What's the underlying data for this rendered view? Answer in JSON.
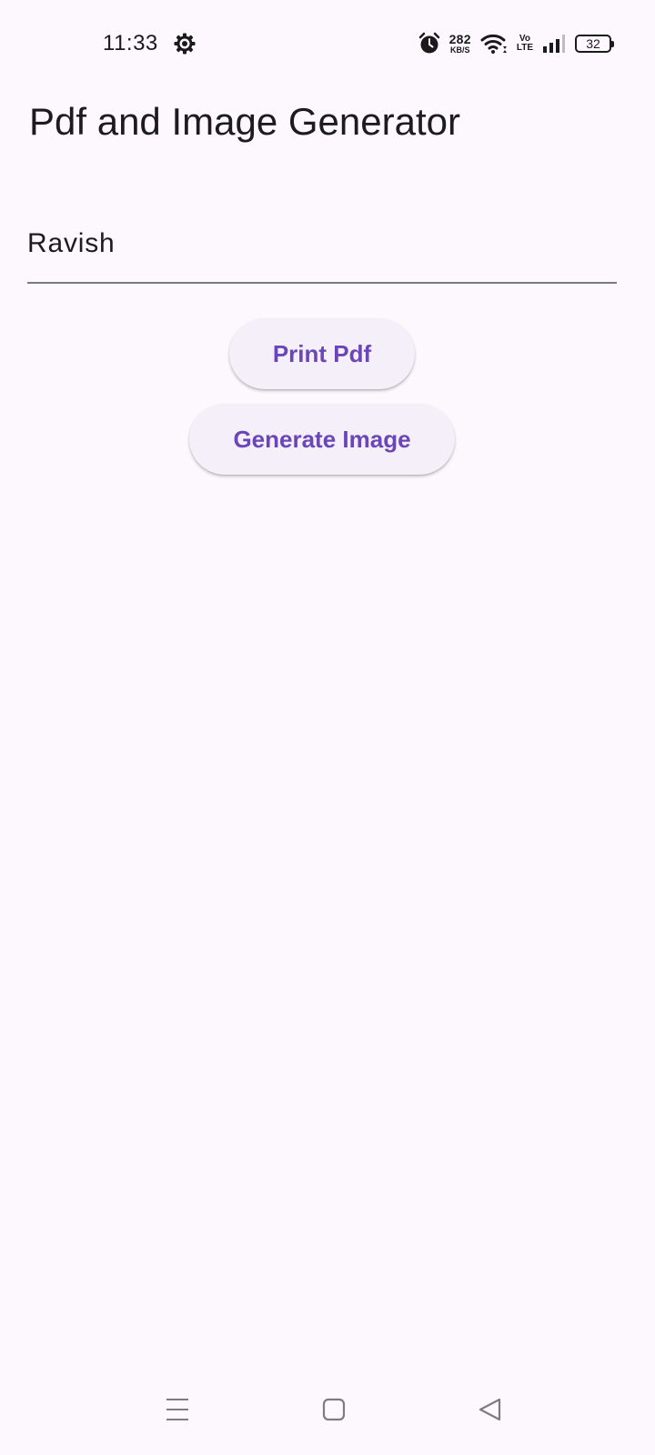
{
  "status_bar": {
    "time": "11:33",
    "net_speed_value": "282",
    "net_speed_unit": "KB/S",
    "volte_top": "Vo",
    "volte_bottom": "LTE",
    "battery": "32",
    "icons": [
      "settings-gear-icon",
      "alarm-icon",
      "wifi-icon",
      "signal-icon",
      "battery-icon"
    ]
  },
  "app_bar": {
    "title": "Pdf and Image Generator"
  },
  "form": {
    "name_value": "Ravish"
  },
  "buttons": {
    "print_pdf": "Print Pdf",
    "generate_image": "Generate Image"
  },
  "nav_bar": {
    "icons": [
      "menu-icon",
      "home-icon",
      "back-icon"
    ]
  },
  "colors": {
    "background": "#fdf8fd",
    "button_background": "#f4eff8",
    "button_text": "#6b46b8",
    "underline": "#7a7a7a"
  }
}
